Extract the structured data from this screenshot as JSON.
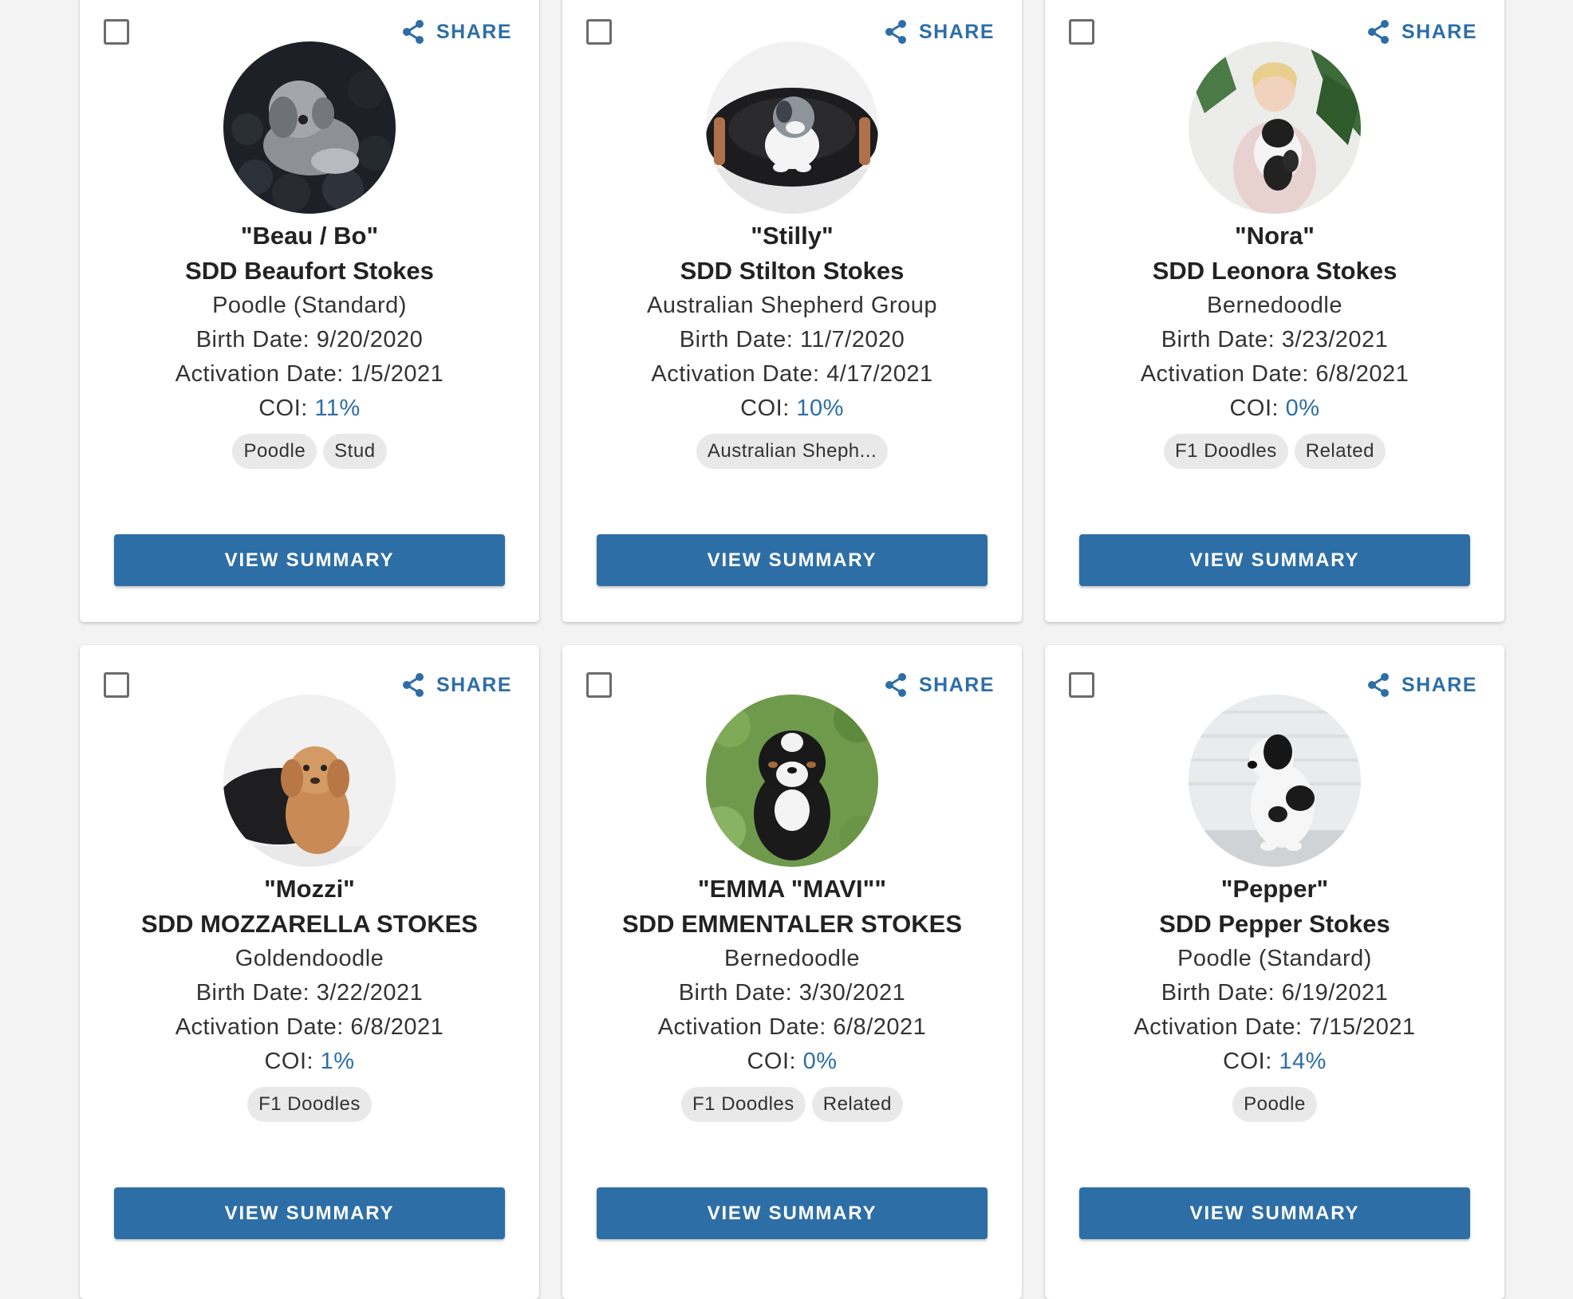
{
  "cards": [
    {
      "nickname": "\"Beau / Bo\"",
      "registered_name": "SDD Beaufort Stokes",
      "breed": "Poodle (Standard)",
      "birth_label": "Birth Date: ",
      "birth_date": "9/20/2020",
      "activation_label": "Activation Date: ",
      "activation_date": "1/5/2021",
      "coi_label": "COI: ",
      "coi": "11%",
      "tags": [
        "Poodle",
        "Stud"
      ],
      "share_label": "SHARE",
      "button_label": "VIEW SUMMARY",
      "photo_icon": "gray-poodle-puppy-photo"
    },
    {
      "nickname": "\"Stilly\"",
      "registered_name": "SDD Stilton Stokes",
      "breed": "Australian Shepherd Group",
      "birth_label": "Birth Date: ",
      "birth_date": "11/7/2020",
      "activation_label": "Activation Date: ",
      "activation_date": "4/17/2021",
      "coi_label": "COI: ",
      "coi": "10%",
      "tags": [
        "Australian Sheph..."
      ],
      "share_label": "SHARE",
      "button_label": "VIEW SUMMARY",
      "photo_icon": "aussie-puppy-in-chair-photo"
    },
    {
      "nickname": "\"Nora\"",
      "registered_name": "SDD Leonora Stokes",
      "breed": "Bernedoodle",
      "birth_label": "Birth Date: ",
      "birth_date": "3/23/2021",
      "activation_label": "Activation Date: ",
      "activation_date": "6/8/2021",
      "coi_label": "COI: ",
      "coi": "0%",
      "tags": [
        "F1 Doodles",
        "Related"
      ],
      "share_label": "SHARE",
      "button_label": "VIEW SUMMARY",
      "photo_icon": "girl-holding-puppy-photo"
    },
    {
      "nickname": "\"Mozzi\"",
      "registered_name": "SDD MOZZARELLA STOKES",
      "breed": "Goldendoodle",
      "birth_label": "Birth Date: ",
      "birth_date": "3/22/2021",
      "activation_label": "Activation Date: ",
      "activation_date": "6/8/2021",
      "coi_label": "COI: ",
      "coi": "1%",
      "tags": [
        "F1 Doodles"
      ],
      "share_label": "SHARE",
      "button_label": "VIEW SUMMARY",
      "photo_icon": "golden-puppy-photo"
    },
    {
      "nickname": "\"EMMA \"MAVI\"\"",
      "registered_name": "SDD EMMENTALER STOKES",
      "breed": "Bernedoodle",
      "birth_label": "Birth Date: ",
      "birth_date": "3/30/2021",
      "activation_label": "Activation Date: ",
      "activation_date": "6/8/2021",
      "coi_label": "COI: ",
      "coi": "0%",
      "tags": [
        "F1 Doodles",
        "Related"
      ],
      "share_label": "SHARE",
      "button_label": "VIEW SUMMARY",
      "photo_icon": "bernedoodle-puppy-on-grass-photo"
    },
    {
      "nickname": "\"Pepper\"",
      "registered_name": "SDD Pepper Stokes",
      "breed": "Poodle (Standard)",
      "birth_label": "Birth Date: ",
      "birth_date": "6/19/2021",
      "activation_label": "Activation Date: ",
      "activation_date": "7/15/2021",
      "coi_label": "COI: ",
      "coi": "14%",
      "tags": [
        "Poodle"
      ],
      "share_label": "SHARE",
      "button_label": "VIEW SUMMARY",
      "photo_icon": "parti-poodle-puppy-photo"
    }
  ],
  "colors": {
    "accent": "#2e6ea6",
    "tag_bg": "#e9e9e9",
    "page_bg": "#f3f3f3"
  }
}
